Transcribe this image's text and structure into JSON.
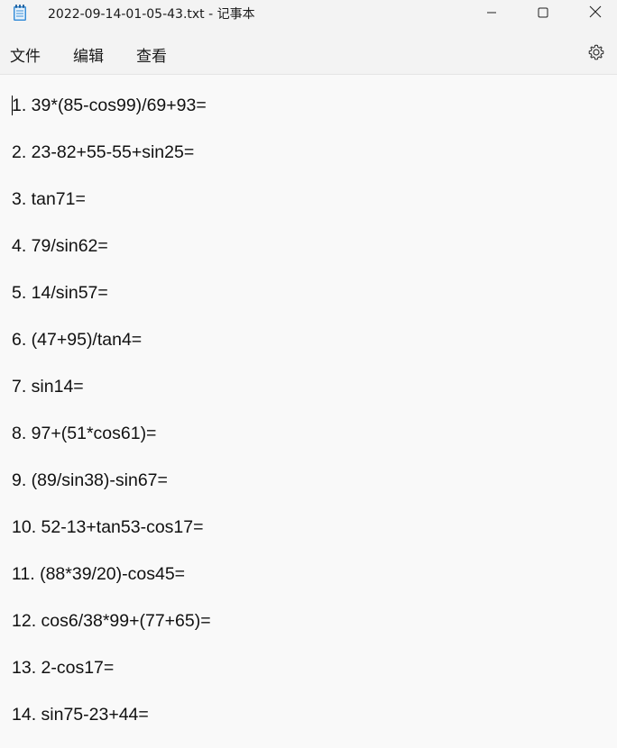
{
  "window": {
    "title": "2022-09-14-01-05-43.txt - 记事本",
    "icon": "notepad-icon",
    "controls": {
      "minimize": "minimize-icon",
      "maximize": "maximize-icon",
      "close": "close-icon"
    }
  },
  "menu": {
    "file": "文件",
    "edit": "编辑",
    "view": "查看",
    "settings_icon": "gear-icon"
  },
  "editor": {
    "lines": [
      "1. 39*(85-cos99)/69+93=",
      "2. 23-82+55-55+sin25=",
      "3. tan71=",
      "4. 79/sin62=",
      "5. 14/sin57=",
      "6. (47+95)/tan4=",
      "7. sin14=",
      "8. 97+(51*cos61)=",
      "9. (89/sin38)-sin67=",
      "10. 52-13+tan53-cos17=",
      "11. (88*39/20)-cos45=",
      "12. cos6/38*99+(77+65)=",
      "13. 2-cos17=",
      "14. sin75-23+44="
    ]
  }
}
